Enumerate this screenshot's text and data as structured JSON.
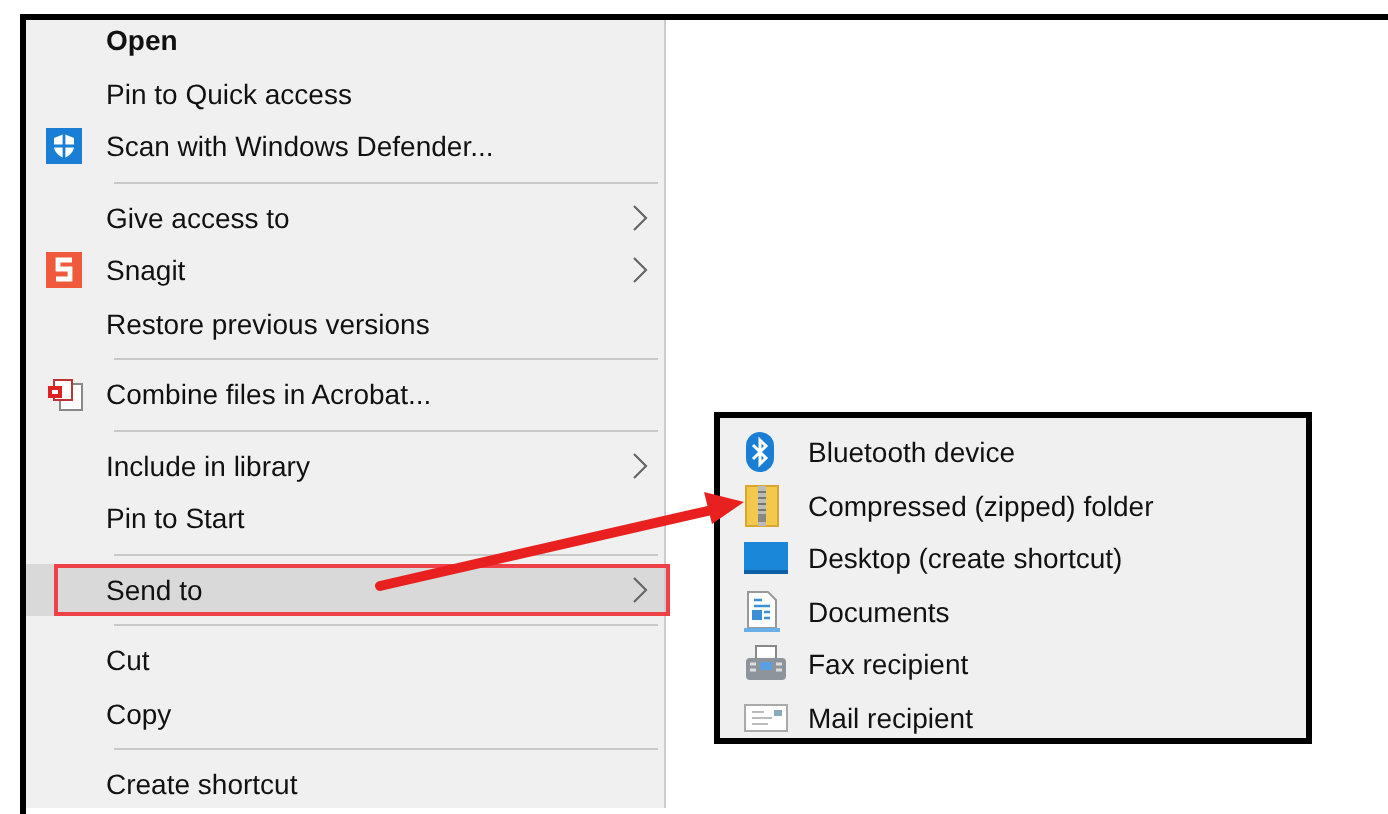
{
  "context_menu": {
    "groups": [
      [
        {
          "label": "Open",
          "kind": "text",
          "default": true,
          "submenu": false,
          "selected": false
        },
        {
          "label": "Pin to Quick access",
          "kind": "text",
          "default": false,
          "submenu": false,
          "selected": false
        },
        {
          "label": "Scan with Windows Defender...",
          "kind": "shield",
          "default": false,
          "submenu": false,
          "selected": false
        }
      ],
      [
        {
          "label": "Give access to",
          "kind": "text",
          "default": false,
          "submenu": true,
          "selected": false
        },
        {
          "label": "Snagit",
          "kind": "snagit",
          "default": false,
          "submenu": true,
          "selected": false
        },
        {
          "label": "Restore previous versions",
          "kind": "text",
          "default": false,
          "submenu": false,
          "selected": false
        }
      ],
      [
        {
          "label": "Combine files in Acrobat...",
          "kind": "acrobat",
          "default": false,
          "submenu": false,
          "selected": false
        }
      ],
      [
        {
          "label": "Include in library",
          "kind": "text",
          "default": false,
          "submenu": true,
          "selected": false
        },
        {
          "label": "Pin to Start",
          "kind": "text",
          "default": false,
          "submenu": false,
          "selected": false
        }
      ],
      [
        {
          "label": "Send to",
          "kind": "text",
          "default": false,
          "submenu": true,
          "selected": true
        }
      ],
      [
        {
          "label": "Cut",
          "kind": "text",
          "default": false,
          "submenu": false,
          "selected": false
        },
        {
          "label": "Copy",
          "kind": "text",
          "default": false,
          "submenu": false,
          "selected": false
        }
      ],
      [
        {
          "label": "Create shortcut",
          "kind": "text",
          "default": false,
          "submenu": false,
          "selected": false
        }
      ]
    ]
  },
  "send_to_menu": {
    "items": [
      {
        "label": "Bluetooth device",
        "kind": "bluetooth"
      },
      {
        "label": "Compressed (zipped) folder",
        "kind": "zip"
      },
      {
        "label": "Desktop (create shortcut)",
        "kind": "desktop"
      },
      {
        "label": "Documents",
        "kind": "documents"
      },
      {
        "label": "Fax recipient",
        "kind": "fax"
      },
      {
        "label": "Mail recipient",
        "kind": "mail"
      }
    ]
  }
}
